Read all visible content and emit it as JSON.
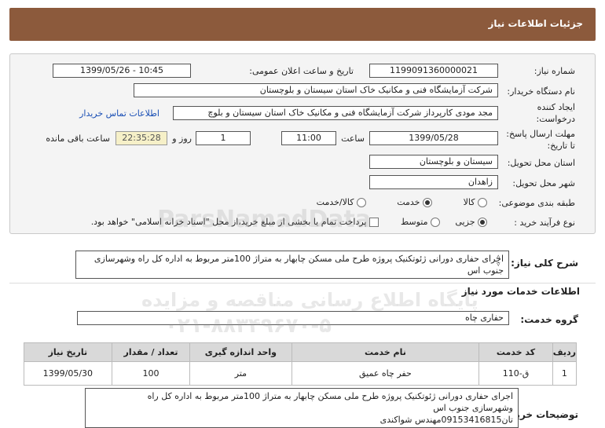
{
  "header": {
    "title": "جزئیات اطلاعات نیاز"
  },
  "fields": {
    "need_number_label": "شماره نیاز:",
    "need_number": "1199091360000021",
    "announce_label": "تاریخ و ساعت اعلان عمومی:",
    "announce_value": "1399/05/26 - 10:45",
    "buyer_label": "نام دستگاه خریدار:",
    "buyer_value": "شرکت آزمایشگاه فنی و مکانیک خاک استان سیستان و بلوچستان",
    "creator_label1": "ایجاد کننده",
    "creator_label2": "درخواست:",
    "creator_value": "مجد مودی کارپرداز شرکت آزمایشگاه فنی و مکانیک خاک استان سیستان و بلوچ",
    "contact_link": "اطلاعات تماس خریدار",
    "deadline_label1": "مهلت ارسال پاسخ:",
    "deadline_label2": "تا تاریخ:",
    "deadline_date": "1399/05/28",
    "hour_label": "ساعت",
    "deadline_time": "11:00",
    "days_value": "1",
    "days_label": "روز و",
    "remaining_time": "22:35:28",
    "remaining_label": "ساعت باقی مانده",
    "province_label": "استان محل تحویل:",
    "province_value": "سیستان و بلوچستان",
    "city_label": "شهر محل تحویل:",
    "city_value": "زاهدان",
    "category_label": "طبقه بندی موضوعی:",
    "category_options": [
      "کالا",
      "خدمت",
      "کالا/خدمت"
    ],
    "category_selected": "خدمت",
    "purchase_label": "نوع فرآیند خرید :",
    "purchase_options": [
      "جزیی",
      "متوسط"
    ],
    "purchase_selected": "جزیی",
    "payment_note": "پرداخت تمام یا بخشی از مبلغ خرید،از محل \"اسناد خزانه اسلامی\" خواهد بود."
  },
  "summary": {
    "label": "شرح کلی نیاز:",
    "text": "اجرای حفاری دورانی ژئوتکنیک پروژه طرح ملی مسکن چابهار به متراژ 100متر مربوط به اداره کل راه وشهرسازی جنوب اس"
  },
  "services": {
    "section_title": "اطلاعات خدمات مورد نیاز",
    "group_label": "گروه خدمت:",
    "group_value": "حفاری چاه",
    "columns": [
      "ردیف",
      "کد خدمت",
      "نام خدمت",
      "واحد اندازه گیری",
      "تعداد / مقدار",
      "تاریخ نیاز"
    ],
    "rows": [
      [
        "1",
        "ق-110",
        "حفر چاه عمیق",
        "متر",
        "100",
        "1399/05/30"
      ]
    ]
  },
  "notes": {
    "label": "توضیحات خریدار:",
    "line1": "اجرای حفاری دورانی ژئوتکنیک پروژه طرح ملی مسکن چابهار به متراژ 100متر مربوط به اداره کل راه",
    "line2": "وشهرسازی جنوب اس",
    "line3": "تان09153416815مهندس شواکندی"
  },
  "watermark": {
    "line1": "ParsNamadData",
    "line2": "پایگاه اطلاع رسانی مناقصه و مزایده",
    "line3": "۰۲۱-۸۸۳۴۹۶۷۰-۵"
  },
  "colors": {
    "title_bar": "#8c5a3c",
    "link": "#1a4fb5"
  }
}
